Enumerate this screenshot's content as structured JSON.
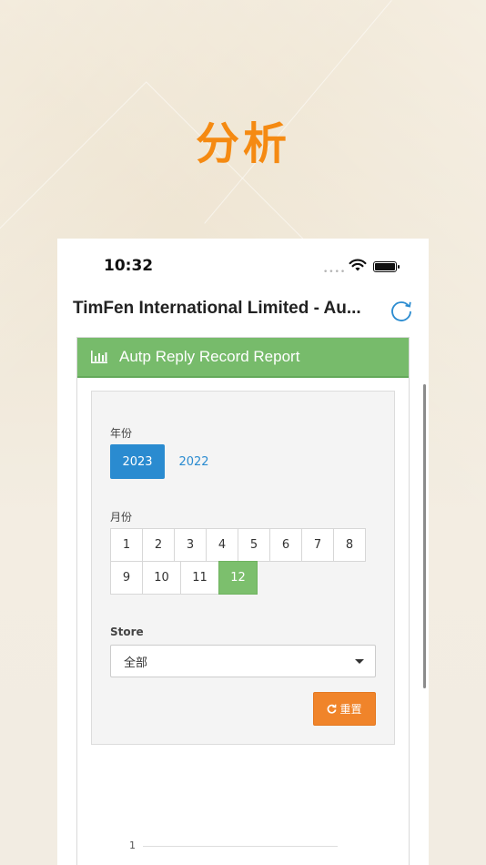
{
  "hero": {
    "title": "分析"
  },
  "status_bar": {
    "time": "10:32",
    "signal": "••••"
  },
  "nav": {
    "title": "TimFen International Limited - Au..."
  },
  "panel": {
    "title": "Autp Reply Record Report"
  },
  "filters": {
    "year_label": "年份",
    "years": [
      {
        "label": "2023",
        "selected": true
      },
      {
        "label": "2022",
        "selected": false
      }
    ],
    "month_label": "月份",
    "months": [
      {
        "label": "1",
        "selected": false
      },
      {
        "label": "2",
        "selected": false
      },
      {
        "label": "3",
        "selected": false
      },
      {
        "label": "4",
        "selected": false
      },
      {
        "label": "5",
        "selected": false
      },
      {
        "label": "6",
        "selected": false
      },
      {
        "label": "7",
        "selected": false
      },
      {
        "label": "8",
        "selected": false
      },
      {
        "label": "9",
        "selected": false
      },
      {
        "label": "10",
        "selected": false
      },
      {
        "label": "11",
        "selected": false
      },
      {
        "label": "12",
        "selected": true
      }
    ],
    "store_label": "Store",
    "store_value": "全部",
    "reset_label": "重置"
  },
  "chart": {
    "y_tick": "1"
  },
  "colors": {
    "accent_orange": "#f58a12",
    "header_green": "#77bb6b",
    "primary_blue": "#2a8bd0",
    "reset_orange": "#f0842a"
  }
}
